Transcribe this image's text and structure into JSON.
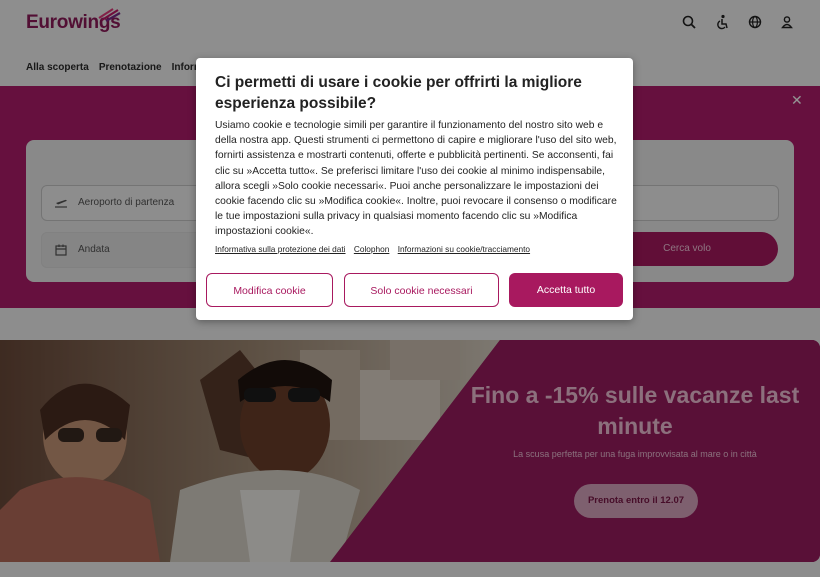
{
  "header": {
    "brand": "Eurowings",
    "icons": [
      "search-icon",
      "accessibility-icon",
      "globe-icon",
      "user-icon"
    ],
    "nav": [
      "Alla scoperta",
      "Prenotazione",
      "Informa"
    ]
  },
  "search": {
    "departure_placeholder": "Aeroporto di partenza",
    "date_placeholder": "Andata",
    "search_button": "Cerca volo"
  },
  "promo": {
    "title": "Fino a -15% sulle vacanze last minute",
    "subtitle": "La scusa perfetta per una fuga improvvisata al mare o in città",
    "button": "Prenota entro il 12.07"
  },
  "cookie_modal": {
    "title": "Ci permetti di usare i cookie per offrirti la migliore esperienza possibile?",
    "body": "Usiamo cookie e tecnologie simili per garantire il funzionamento del nostro sito web e della nostra app. Questi strumenti ci permettono di capire e migliorare l'uso del sito web, fornirti assistenza e mostrarti contenuti, offerte e pubblicità pertinenti. Se acconsenti, fai clic su »Accetta tutto«. Se preferisci limitare l'uso dei cookie al minimo indispensabile, allora scegli »Solo cookie necessari«. Puoi anche personalizzare le impostazioni dei cookie facendo clic su »Modifica cookie«. Inoltre, puoi revocare il consenso o modificare le tue impostazioni sulla privacy in qualsiasi momento facendo clic su »Modifica impostazioni cookie«.",
    "links": [
      "Informativa sulla protezione dei dati",
      "Colophon",
      "Informazioni su cookie/tracciamento"
    ],
    "buttons": {
      "modify": "Modifica cookie",
      "necessary": "Solo cookie necessari",
      "accept": "Accetta tutto"
    }
  },
  "colors": {
    "brand": "#a8195f",
    "band": "#b01d6b",
    "promo_bg": "#9a1c5f"
  }
}
